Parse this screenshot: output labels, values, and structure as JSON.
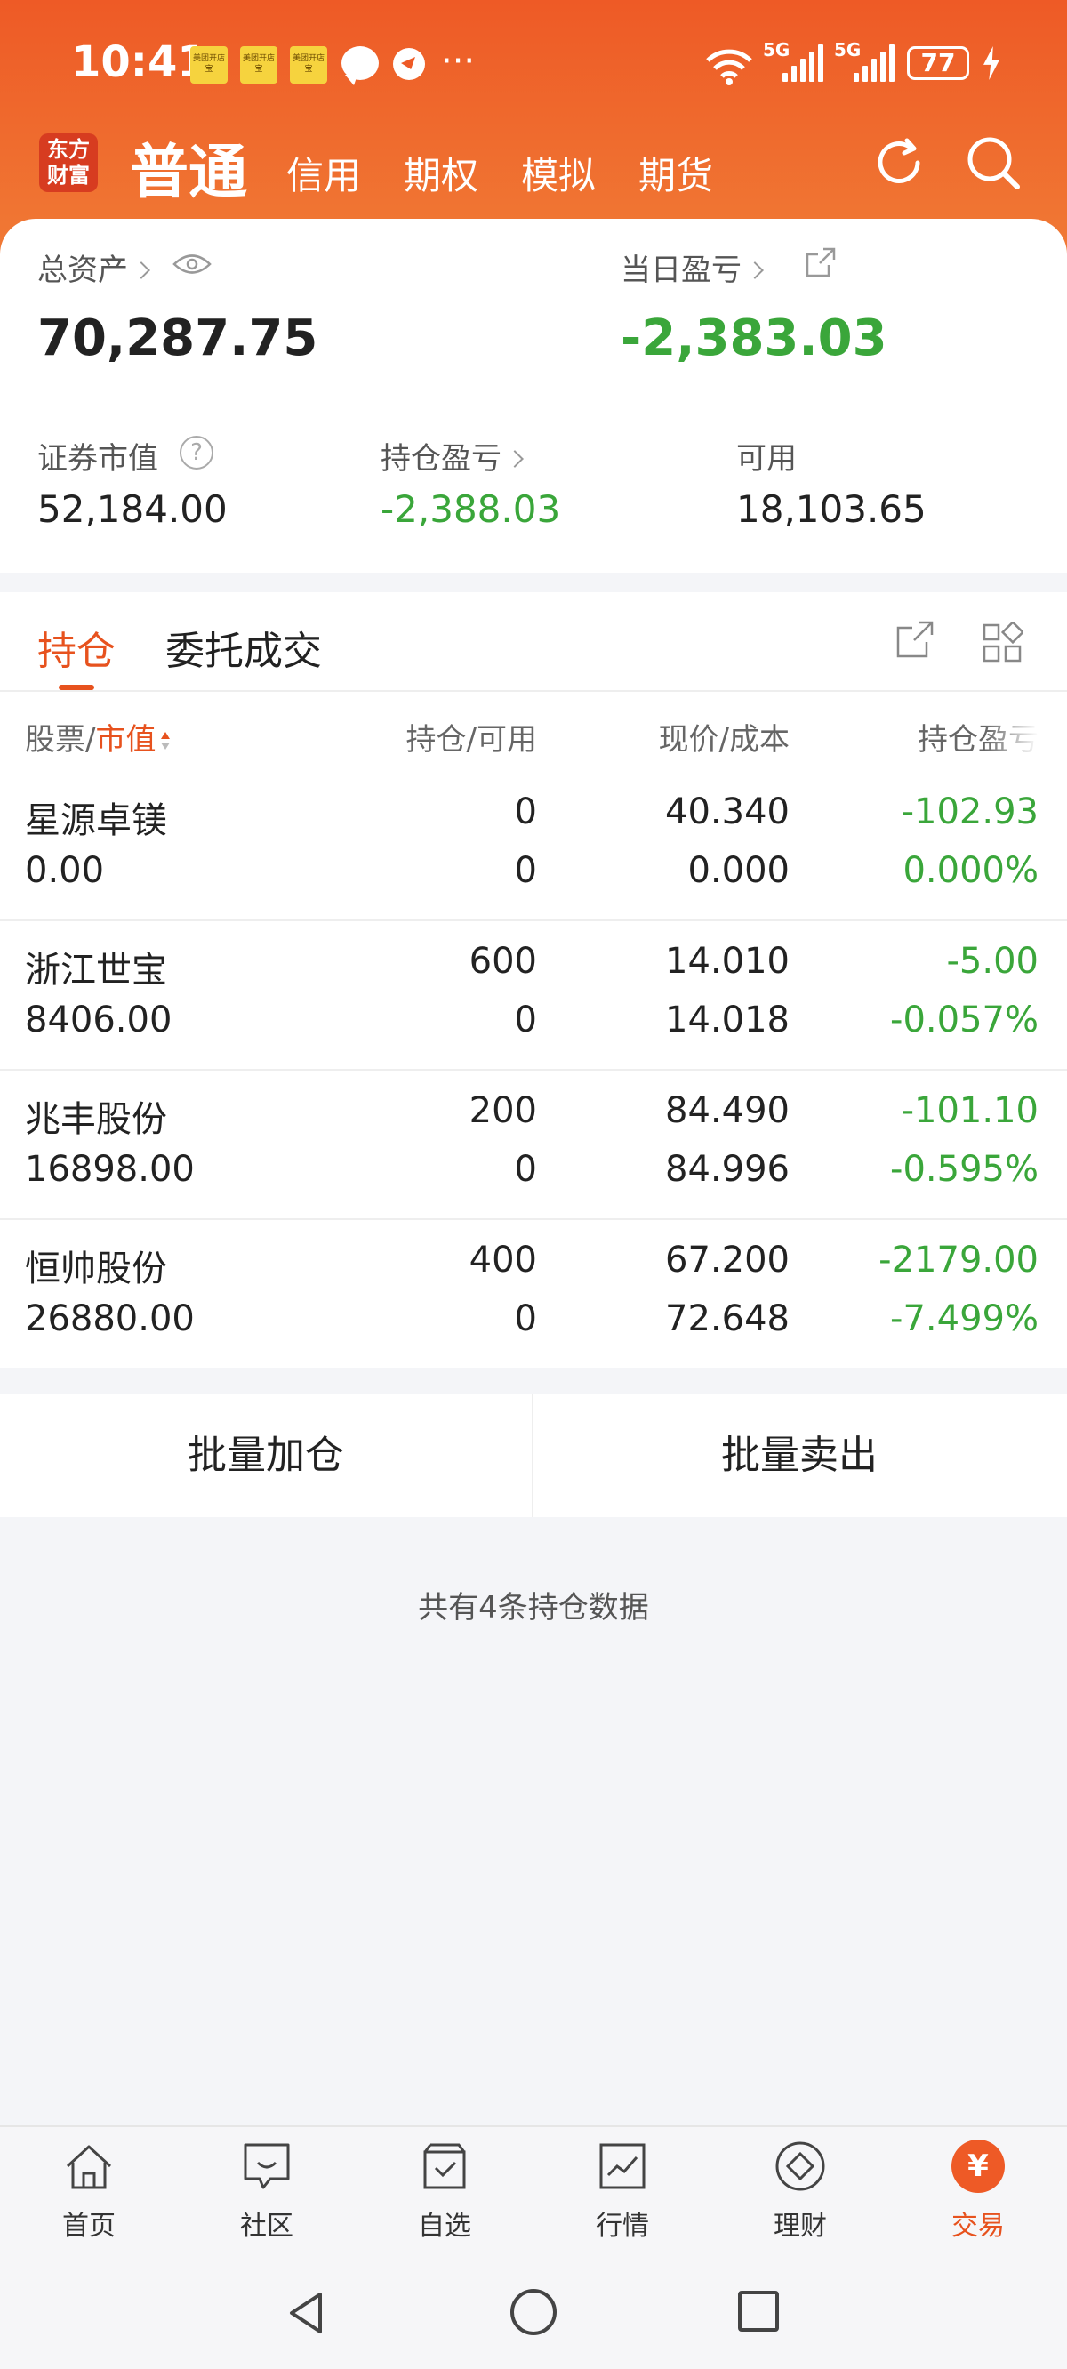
{
  "status_bar": {
    "time": "10:41",
    "note_icon_text": "美团开店宝",
    "signal_1": "5G",
    "signal_2": "5G",
    "battery": "77"
  },
  "header": {
    "logo": "东方财富",
    "title": "普通",
    "tabs": [
      "信用",
      "期权",
      "模拟",
      "期货"
    ]
  },
  "summary": {
    "total_assets_label": "总资产",
    "total_assets_value": "70,287.75",
    "daily_pnl_label": "当日盈亏",
    "daily_pnl_value": "-2,383.03",
    "market_value_label": "证券市值",
    "market_value_value": "52,184.00",
    "position_pnl_label": "持仓盈亏",
    "position_pnl_value": "-2,388.03",
    "available_label": "可用",
    "available_value": "18,103.65"
  },
  "tabs": {
    "holdings": "持仓",
    "orders": "委托成交"
  },
  "table": {
    "headers": {
      "stock": "股票",
      "separator": "/",
      "market_value": "市值",
      "position": "持仓/可用",
      "price": "现价/成本",
      "pnl": "持仓盈亏"
    },
    "rows": [
      {
        "name": "星源卓镁",
        "value": "0.00",
        "hold": "0",
        "avail": "0",
        "price": "40.340",
        "cost": "0.000",
        "pnl": "-102.93",
        "pct": "0.000%"
      },
      {
        "name": "浙江世宝",
        "value": "8406.00",
        "hold": "600",
        "avail": "0",
        "price": "14.010",
        "cost": "14.018",
        "pnl": "-5.00",
        "pct": "-0.057%"
      },
      {
        "name": "兆丰股份",
        "value": "16898.00",
        "hold": "200",
        "avail": "0",
        "price": "84.490",
        "cost": "84.996",
        "pnl": "-101.10",
        "pct": "-0.595%"
      },
      {
        "name": "恒帅股份",
        "value": "26880.00",
        "hold": "400",
        "avail": "0",
        "price": "67.200",
        "cost": "72.648",
        "pnl": "-2179.00",
        "pct": "-7.499%"
      }
    ]
  },
  "actions": {
    "batch_add": "批量加仓",
    "batch_sell": "批量卖出"
  },
  "footer_note": "共有4条持仓数据",
  "bottom_nav": [
    "首页",
    "社区",
    "自选",
    "行情",
    "理财",
    "交易"
  ],
  "trade_icon_glyph": "¥",
  "colors": {
    "accent": "#e7521e",
    "header": "#ee5a26",
    "loss_green": "#3aa63a"
  }
}
